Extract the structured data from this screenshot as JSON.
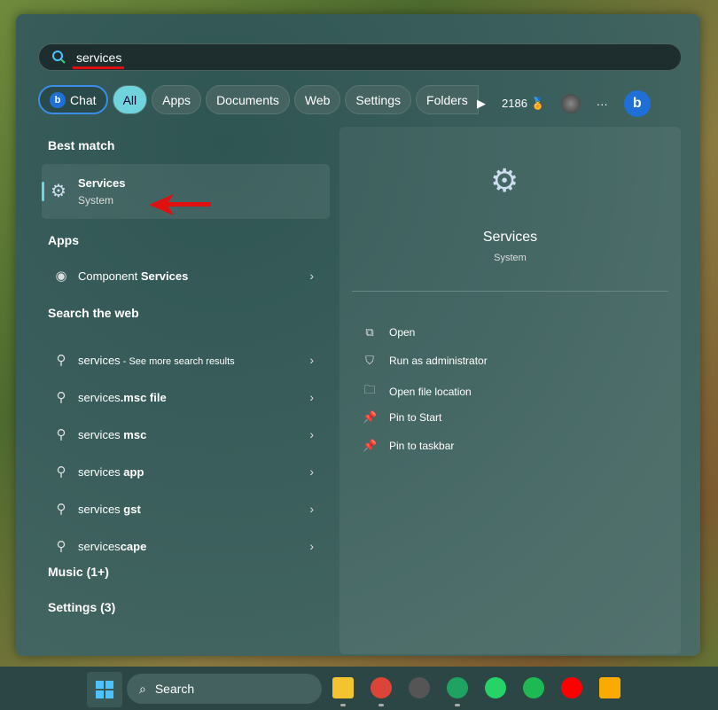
{
  "search": {
    "value": "services",
    "icon": "search-icon"
  },
  "chips": [
    {
      "label": "Chat",
      "icon": "bing-icon"
    },
    {
      "label": "All"
    },
    {
      "label": "Apps"
    },
    {
      "label": "Documents"
    },
    {
      "label": "Web"
    },
    {
      "label": "Settings"
    },
    {
      "label": "Folders"
    }
  ],
  "toolbar": {
    "points": "2186",
    "more": "···"
  },
  "sections": {
    "best": "Best match",
    "apps": "Apps",
    "web": "Search the web",
    "music": "Music (1+)",
    "settings": "Settings (3)"
  },
  "best_match": {
    "title": "Services",
    "subtitle": "System"
  },
  "apps": [
    {
      "prefix": "Component ",
      "bold": "Services"
    }
  ],
  "web": [
    {
      "prefix": "services",
      "bold": "",
      "suffix": " - See more search results"
    },
    {
      "prefix": "services",
      "bold": ".msc file",
      "suffix": ""
    },
    {
      "prefix": "services ",
      "bold": "msc",
      "suffix": ""
    },
    {
      "prefix": "services ",
      "bold": "app",
      "suffix": ""
    },
    {
      "prefix": "services ",
      "bold": "gst",
      "suffix": ""
    },
    {
      "prefix": "services",
      "bold": "cape",
      "suffix": ""
    }
  ],
  "detail": {
    "title": "Services",
    "subtitle": "System",
    "actions": [
      {
        "label": "Open",
        "icon": "open-external-icon"
      },
      {
        "label": "Run as administrator",
        "icon": "shield-icon"
      },
      {
        "label": "Open file location",
        "icon": "folder-icon"
      },
      {
        "label": "Pin to Start",
        "icon": "pin-icon"
      },
      {
        "label": "Pin to taskbar",
        "icon": "pin-icon"
      }
    ]
  },
  "taskbar": {
    "search_label": "Search",
    "apps": [
      "File Explorer",
      "Chrome",
      "App",
      "Google Chat",
      "WhatsApp",
      "Spotify",
      "YouTube Music",
      "Google Keep"
    ]
  },
  "colors": {
    "accent": "#6fd4dc",
    "annotation": "#e01010"
  }
}
